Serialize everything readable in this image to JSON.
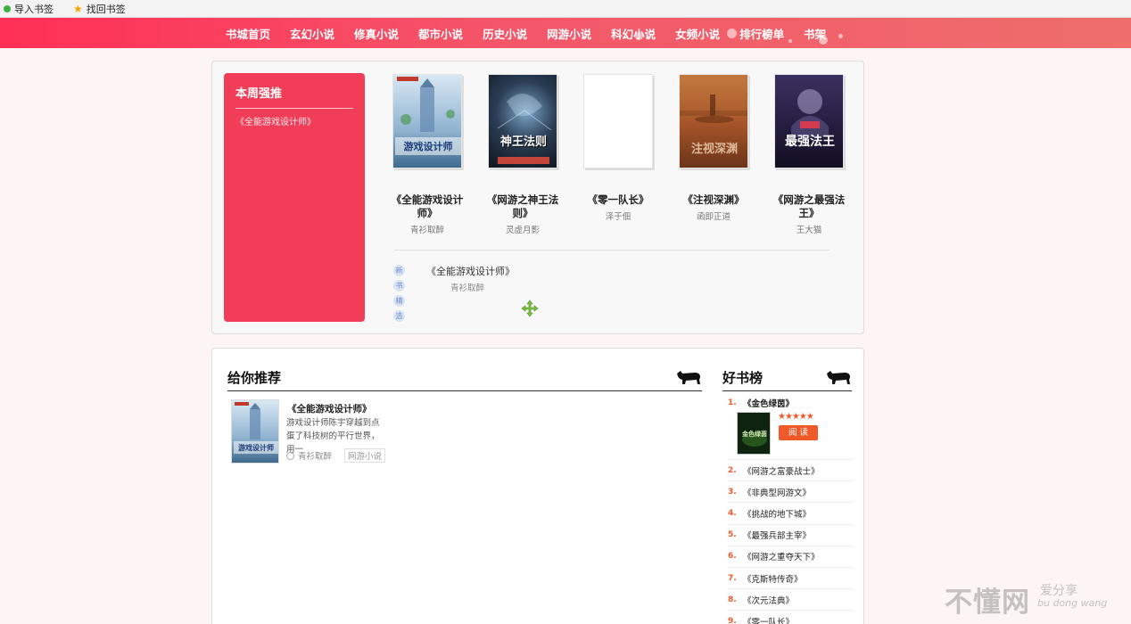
{
  "bookmarks": [
    {
      "label": "导入书签",
      "icon": "green-dot-icon"
    },
    {
      "label": "找回书签",
      "icon": "star-icon"
    }
  ],
  "nav": {
    "items": [
      "书城首页",
      "玄幻小说",
      "修真小说",
      "都市小说",
      "历史小说",
      "网游小说",
      "科幻小说",
      "女频小说",
      "排行榜单",
      "书架"
    ],
    "gradient": [
      "#ff2f55",
      "#ee6e6b"
    ]
  },
  "weekly": {
    "title": "本周强推",
    "items": [
      "《全能游戏设计师》"
    ],
    "color": "#f23d58"
  },
  "books": [
    {
      "title": "《全能游戏设计师》",
      "author": "青衫取醉",
      "cover_text": "游戏设计师",
      "cover_color": "#bcd4e6"
    },
    {
      "title": "《网游之神王法则》",
      "author": "灵虚月影",
      "cover_text": "神王法则",
      "cover_color": "#1b2536"
    },
    {
      "title": "《零一队长》",
      "author": "泽于佃",
      "cover_text": "",
      "cover_color": "#ffffff"
    },
    {
      "title": "《注视深渊》",
      "author": "函即正道",
      "cover_text": "注视深渊",
      "cover_color": "#b5602a"
    },
    {
      "title": "《网游之最强法王》",
      "author": "王大猫",
      "cover_text": "最强法王",
      "cover_color": "#2a2244"
    }
  ],
  "new_books": {
    "badge": [
      "新",
      "书",
      "精",
      "选"
    ],
    "title": "《全能游戏设计师》",
    "author": "青衫取醉"
  },
  "recommend": {
    "title": "给你推荐",
    "book_title": "《全能游戏设计师》",
    "desc": "游戏设计师陈宇穿越到点蛋了科技树的平行世界，用一",
    "author": "青衫取醉",
    "tag": "网游小说"
  },
  "ranking": {
    "title": "好书榜",
    "first": {
      "num": "1.",
      "name": "《金色绿茵》",
      "stars": "★★★★★",
      "read_label": "阅 读"
    },
    "items": [
      {
        "num": "2.",
        "name": "《网游之富豪战士》"
      },
      {
        "num": "3.",
        "name": "《非典型网游文》"
      },
      {
        "num": "4.",
        "name": "《挑战的地下城》"
      },
      {
        "num": "5.",
        "name": "《最强兵部主宰》"
      },
      {
        "num": "6.",
        "name": "《网游之重夺天下》"
      },
      {
        "num": "7.",
        "name": "《克斯特传奇》"
      },
      {
        "num": "8.",
        "name": "《次元法典》"
      },
      {
        "num": "9.",
        "name": "《零一队长》"
      }
    ],
    "accent": "#f05a28"
  },
  "watermark": {
    "big": "不懂网",
    "small": "爱分享",
    "pinyin": "bu dong wang"
  }
}
